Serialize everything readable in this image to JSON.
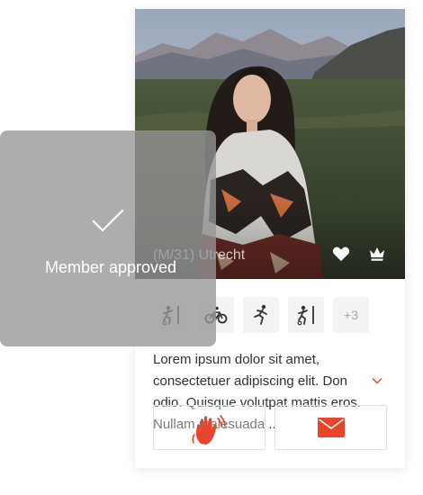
{
  "profile": {
    "caption": "(M/31) Utrecht",
    "actions": {
      "like_icon": "heart-icon",
      "premium_icon": "crown-icon"
    }
  },
  "sports": {
    "items": [
      {
        "icon": "soccer-icon"
      },
      {
        "icon": "cycling-icon"
      },
      {
        "icon": "running-icon"
      },
      {
        "icon": "soccer-icon"
      }
    ],
    "more_label": "+3"
  },
  "description": {
    "text": "Lorem ipsum dolor sit amet, consectetuer adipiscing elit. Don odio. Quisque volutpat mattis eros. Nullam malesuada .."
  },
  "buttons": {
    "wave_icon": "wave-hand-icon",
    "message_icon": "envelope-icon"
  },
  "toast": {
    "message": "Member approved",
    "icon": "checkmark-icon"
  },
  "colors": {
    "accent": "#e8452c",
    "toast_bg": "#969696"
  }
}
